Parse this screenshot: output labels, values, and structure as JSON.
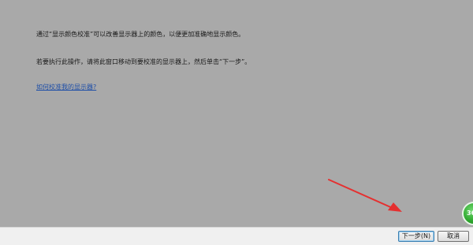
{
  "content": {
    "intro_text": "通过“显示颜色校准”可以改善显示器上的颜色，以便更加准确地显示颜色。",
    "instruction_text": "若要执行此操作，请将此窗口移动到要校准的显示器上，然后单击“下一步”。",
    "help_link": "如何校准我的显示器?"
  },
  "widget": {
    "label": "36"
  },
  "buttons": {
    "next_label": "下一步(N)",
    "cancel_label": "取消"
  },
  "colors": {
    "background": "#a9a9a9",
    "link": "#1f4fa8",
    "annotation_arrow": "#e53030",
    "footer": "#f0f0f0"
  }
}
